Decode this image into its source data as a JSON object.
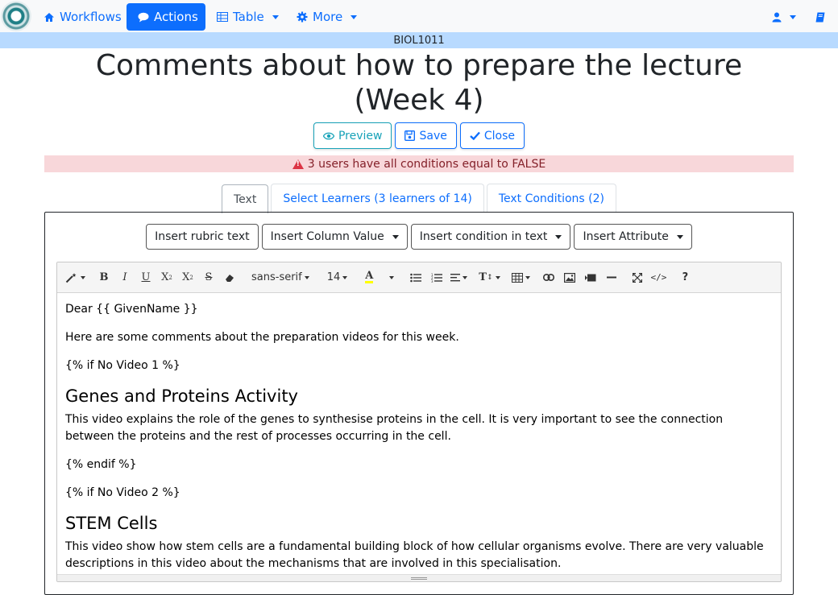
{
  "navbar": {
    "items": [
      {
        "label": "Workflows"
      },
      {
        "label": "Actions"
      },
      {
        "label": "Table"
      },
      {
        "label": "More"
      }
    ]
  },
  "course": {
    "code": "BIOL1011"
  },
  "page": {
    "title": "Comments about how to prepare the lecture (Week 4)"
  },
  "actions": {
    "preview": "Preview",
    "save": "Save",
    "close": "Close"
  },
  "alert": {
    "text": "3 users have all conditions equal to FALSE"
  },
  "tabs": [
    {
      "label": "Text"
    },
    {
      "label": "Select Learners (3 learners of 14)"
    },
    {
      "label": "Text Conditions (2)"
    }
  ],
  "insert": {
    "rubric": "Insert rubric text",
    "column": "Insert Column Value",
    "condition": "Insert condition in text",
    "attribute": "Insert Attribute"
  },
  "toolbar": {
    "font": "sans-serif",
    "size": "14",
    "highlight_color": "#ffff00"
  },
  "content": {
    "greeting": "Dear {{ GivenName }}",
    "intro": "Here are some comments about the preparation videos for this week.",
    "if1": "{% if No Video 1 %}",
    "heading1": "Genes and Proteins Activity",
    "body1": "This video explains the role of the genes to synthesise proteins in the cell. It is very important to see the connection between the proteins and the rest of processes occurring in the cell.",
    "endif": "{% endif %}",
    "if2": "{% if No Video 2 %}",
    "heading2": "STEM Cells",
    "body2": "This video show how stem cells are a fundamental building block of how cellular organisms evolve. There are very valuable descriptions in this video about the mechanisms that are involved in this specialisation."
  }
}
